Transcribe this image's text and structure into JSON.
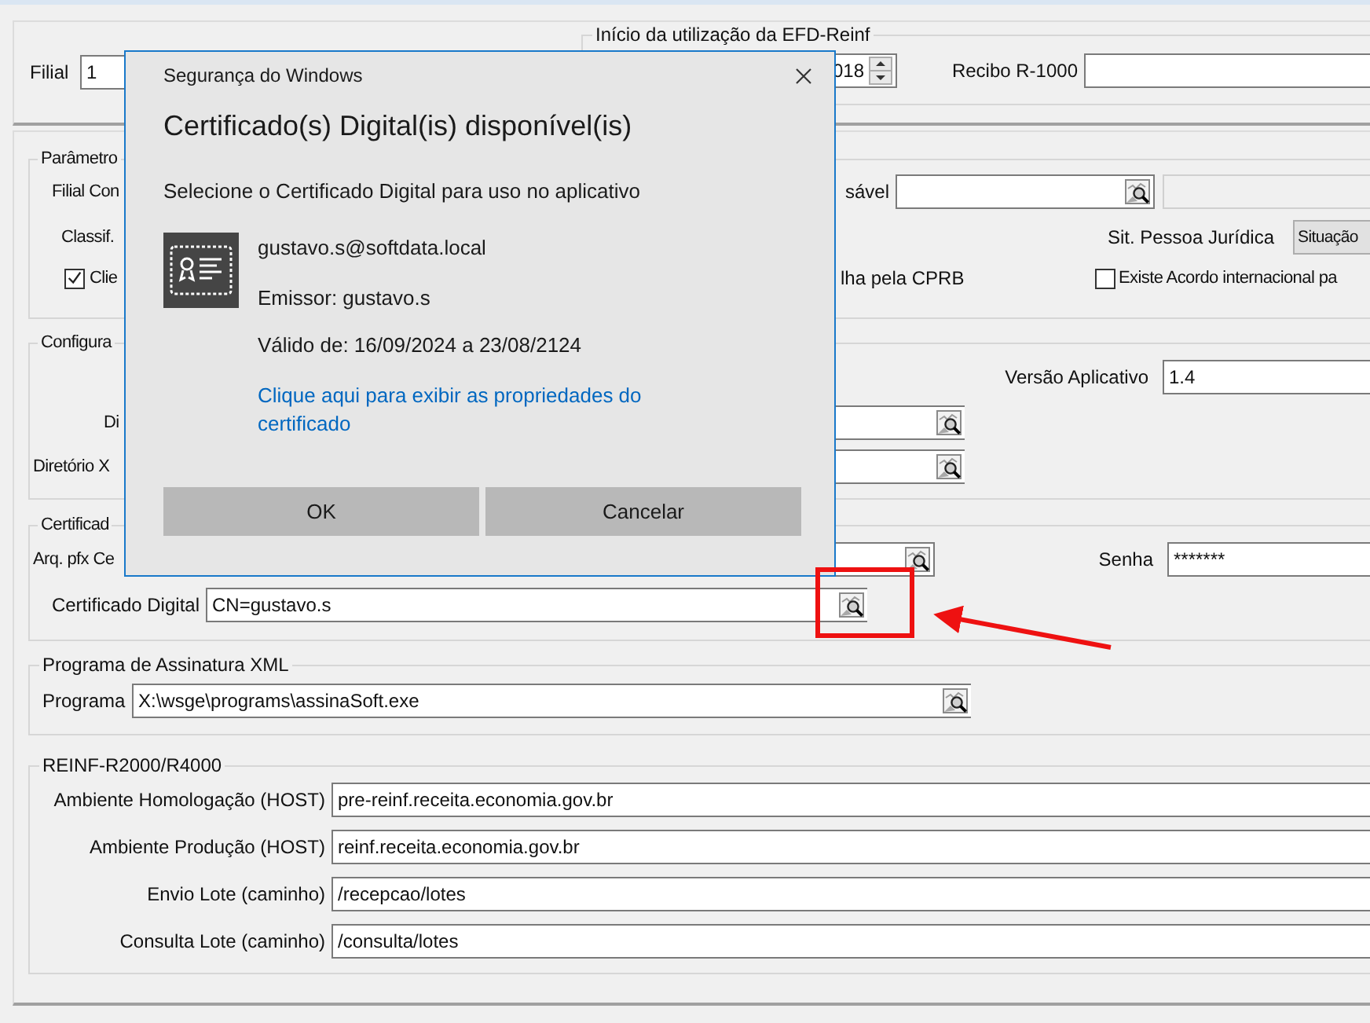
{
  "top_panel": {
    "filial_label": "Filial",
    "filial_value": "1",
    "inicio_legend": "Início da utilização da EFD-Reinf",
    "inicio_year": "018",
    "recibo_label": "Recibo R-1000"
  },
  "parametros": {
    "legend": "Parâmetro",
    "filial_label": "Filial Con",
    "responsavel_label": "sável",
    "classif_label": "Classif.",
    "situacao_label": "Sit. Pessoa Jurídica",
    "situacao_value": "Situação",
    "cprb_text": "lha pela CPRB",
    "checks": [
      {
        "label": "Clie",
        "checked": true
      },
      {
        "label": "Existe Acordo internacional pa",
        "checked": false
      }
    ]
  },
  "configuracao": {
    "legend": "Configura",
    "versao_label": "Versão Aplicativo",
    "versao_value": "1.4",
    "dir_label": "Di",
    "dir_xml_label": "Diretório X"
  },
  "certificado": {
    "legend": "Certificad",
    "pfx_label": "Arq. pfx Ce",
    "senha_label": "Senha",
    "senha_value": "*******",
    "digital_label": "Certificado Digital",
    "digital_value": "CN=gustavo.s"
  },
  "programa": {
    "legend": "Programa de Assinatura XML",
    "label": "Programa",
    "value": "X:\\wsge\\programs\\assinaSoft.exe"
  },
  "reinf": {
    "legend": "REINF-R2000/R4000",
    "rows": [
      {
        "label": "Ambiente Homologação (HOST)",
        "value": "pre-reinf.receita.economia.gov.br"
      },
      {
        "label": "Ambiente Produção (HOST)",
        "value": "reinf.receita.economia.gov.br"
      },
      {
        "label": "Envio Lote (caminho)",
        "value": "/recepcao/lotes"
      },
      {
        "label": "Consulta Lote (caminho)",
        "value": "/consulta/lotes"
      }
    ]
  },
  "dialog": {
    "caption": "Segurança do Windows",
    "heading": "Certificado(s) Digital(is) disponível(is)",
    "instruction": "Selecione o Certificado Digital para uso no aplicativo",
    "certificate": {
      "subject": "gustavo.s@softdata.local",
      "issuer": "Emissor: gustavo.s",
      "validity": "Válido de: 16/09/2024 a 23/08/2124"
    },
    "link": "Clique aqui para exibir as propriedades do certificado",
    "buttons": [
      "OK",
      "Cancelar"
    ]
  }
}
